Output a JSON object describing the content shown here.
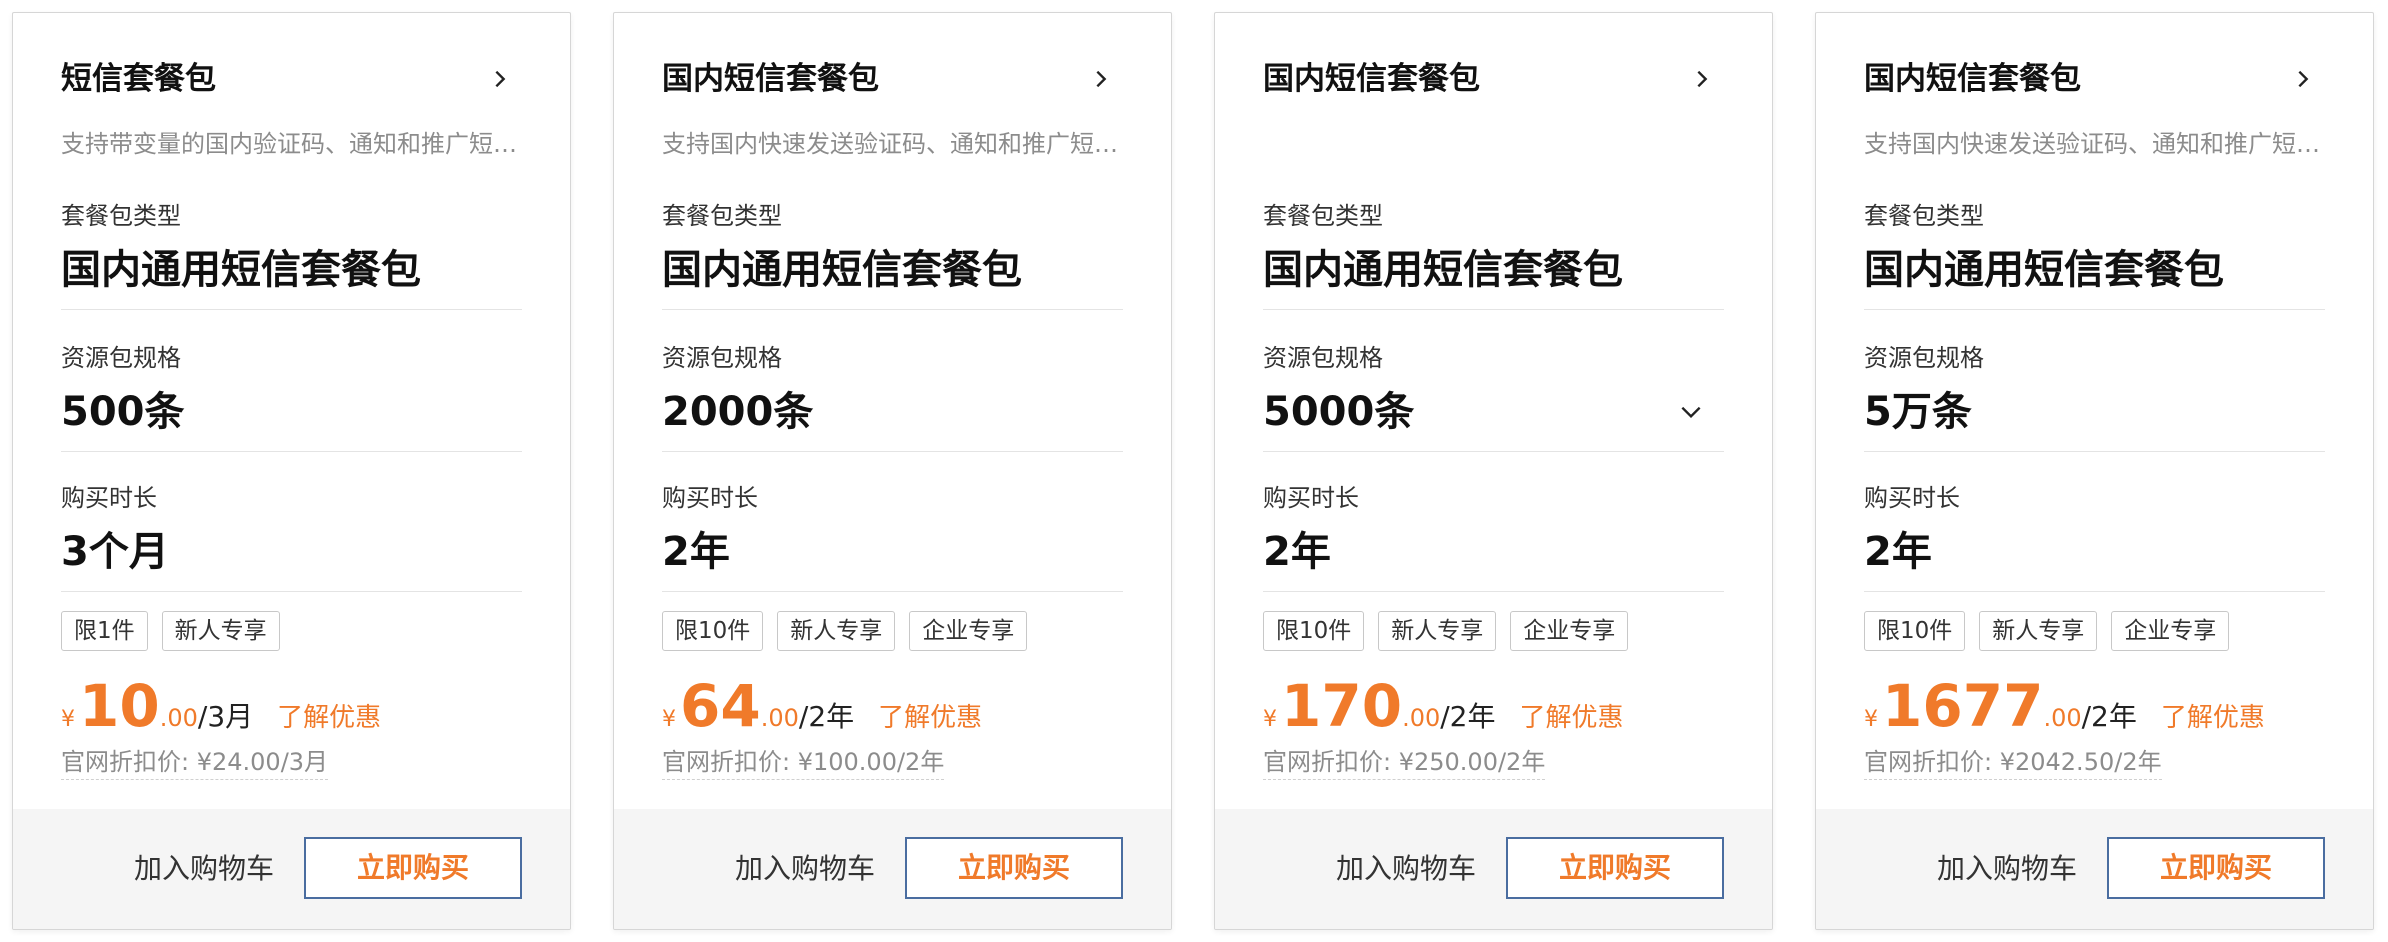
{
  "labels": {
    "type": "套餐包类型",
    "spec": "资源包规格",
    "duration": "购买时长",
    "promo": "了解优惠",
    "cart": "加入购物车",
    "buy": "立即购买",
    "currency": "¥"
  },
  "colors": {
    "accent": "#f07a2a",
    "button_border": "#4a6da0",
    "footer_bg": "#f5f5f5"
  },
  "cards": [
    {
      "title": "短信套餐包",
      "desc": "支持带变量的国内验证码、通知和推广短…",
      "type": "国内通用短信套餐包",
      "spec": "500条",
      "duration": "3个月",
      "tags": [
        "限1件",
        "新人专享"
      ],
      "price_int": "10",
      "price_dec": ".00",
      "price_per": "/3月",
      "original": "官网折扣价: ¥24.00/3月"
    },
    {
      "title": "国内短信套餐包",
      "desc": "支持国内快速发送验证码、通知和推广短…",
      "type": "国内通用短信套餐包",
      "spec": "2000条",
      "duration": "2年",
      "tags": [
        "限10件",
        "新人专享",
        "企业专享"
      ],
      "price_int": "64",
      "price_dec": ".00",
      "price_per": "/2年",
      "original": "官网折扣价: ¥100.00/2年"
    },
    {
      "title": "国内短信套餐包",
      "desc": "",
      "type": "国内通用短信套餐包",
      "spec": "5000条",
      "duration": "2年",
      "tags": [
        "限10件",
        "新人专享",
        "企业专享"
      ],
      "price_int": "170",
      "price_dec": ".00",
      "price_per": "/2年",
      "original": "官网折扣价: ¥250.00/2年"
    },
    {
      "title": "国内短信套餐包",
      "desc": "支持国内快速发送验证码、通知和推广短…",
      "type": "国内通用短信套餐包",
      "spec": "5万条",
      "duration": "2年",
      "tags": [
        "限10件",
        "新人专享",
        "企业专享"
      ],
      "price_int": "1677",
      "price_dec": ".00",
      "price_per": "/2年",
      "original": "官网折扣价: ¥2042.50/2年"
    }
  ]
}
